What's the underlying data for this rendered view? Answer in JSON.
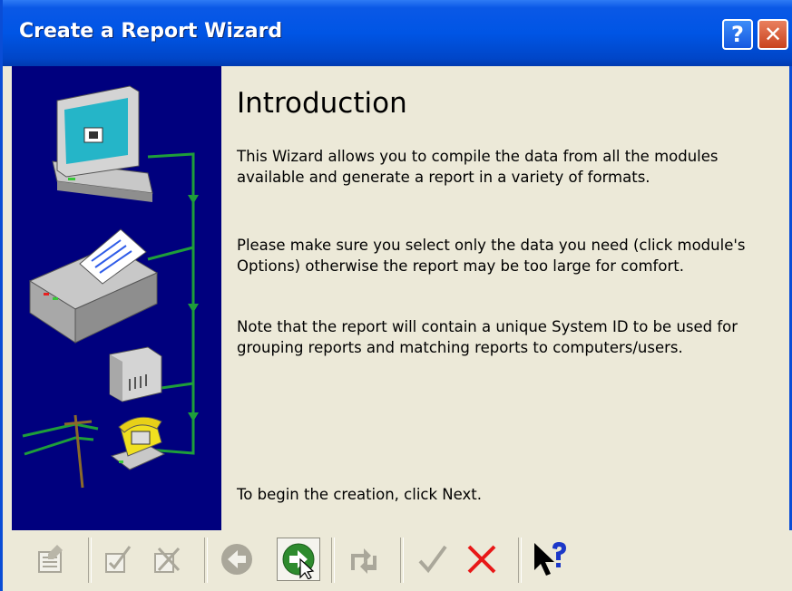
{
  "window": {
    "title": "Create a Report Wizard",
    "help_label": "?",
    "close_label": "✕"
  },
  "page": {
    "heading": "Introduction",
    "paragraphs": [
      "This Wizard allows you to compile the data from all the modules available and generate a report in a variety of formats.",
      "Please make sure you select only the data you need (click module's Options) otherwise the report may be too large for comfort.",
      "Note that the report will contain a unique System ID to be used for grouping reports and matching reports to computers/users."
    ],
    "footer_text": "To begin the creation, click Next."
  },
  "toolbar": {
    "buttons": [
      {
        "icon": "report-form-icon",
        "enabled": false
      },
      {
        "icon": "checkbox-edit-icon",
        "enabled": false
      },
      {
        "icon": "checkbox-delete-icon",
        "enabled": false
      },
      {
        "icon": "back-arrow-icon",
        "enabled": false
      },
      {
        "icon": "next-arrow-icon",
        "enabled": true
      },
      {
        "icon": "finish-arrow-icon",
        "enabled": false
      },
      {
        "icon": "checkmark-icon",
        "enabled": false
      },
      {
        "icon": "cancel-x-icon",
        "enabled": true
      },
      {
        "icon": "context-help-icon",
        "enabled": true
      }
    ]
  },
  "colors": {
    "titlebar": "#0055E5",
    "panel": "#00007E",
    "wire": "#1E9E3A",
    "next_button": "#2E8B2E",
    "cancel": "#E81818",
    "help_question": "#1C38C8"
  }
}
